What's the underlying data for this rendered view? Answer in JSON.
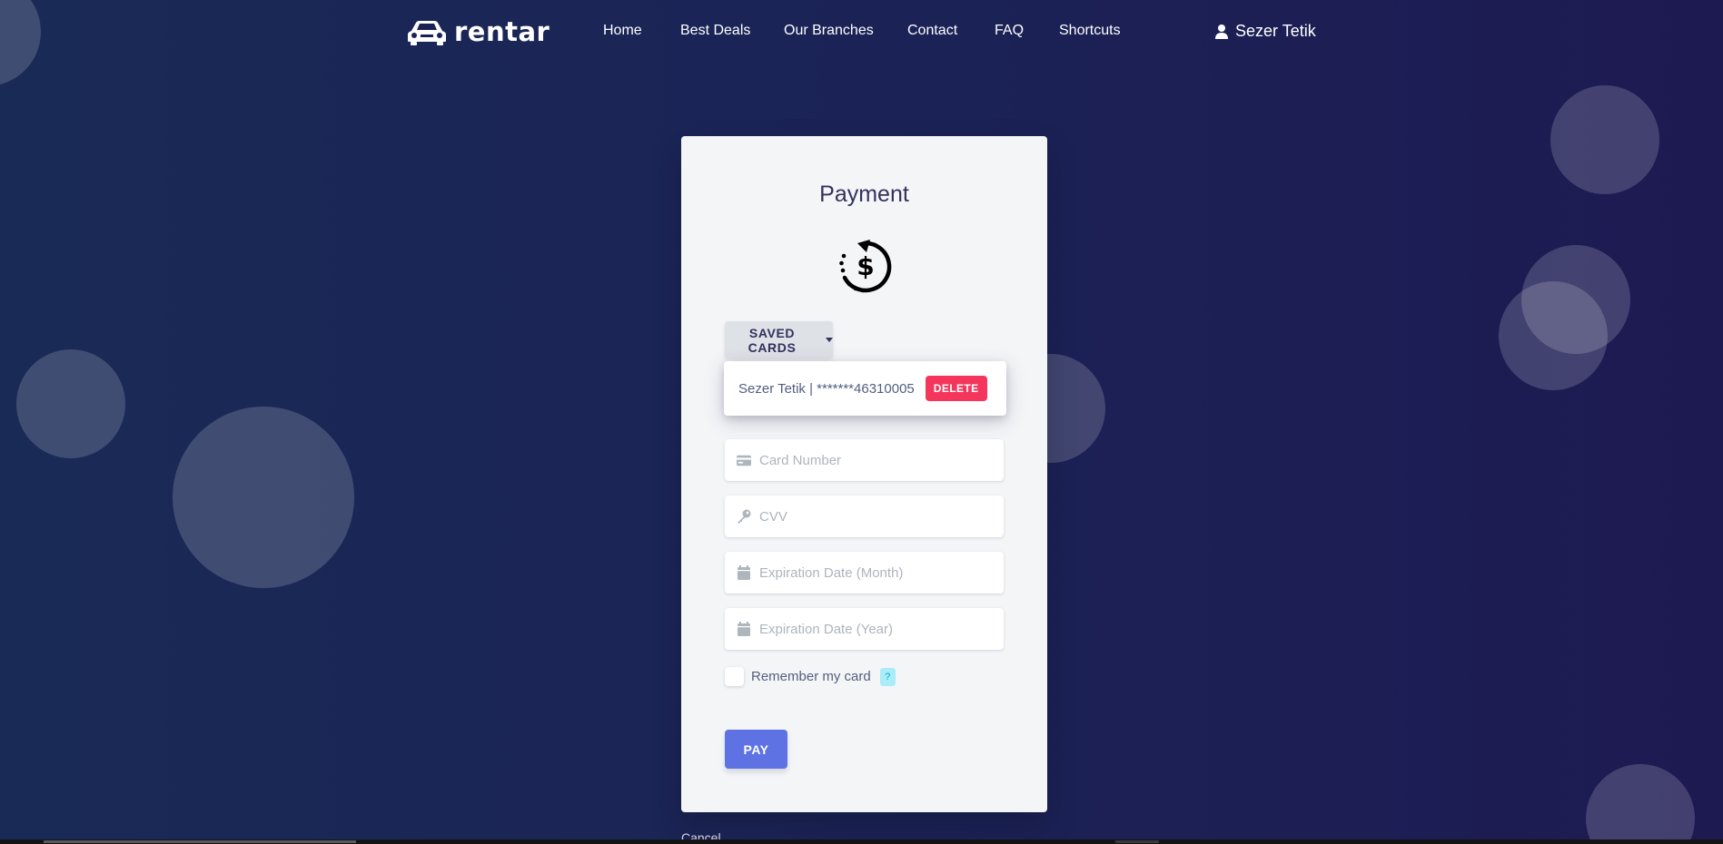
{
  "brand": {
    "name": "rentar",
    "logo_icon": "car-icon"
  },
  "nav": {
    "links": [
      "Home",
      "Best Deals",
      "Our Branches",
      "Contact",
      "FAQ",
      "Shortcuts"
    ]
  },
  "user": {
    "name": "Sezer Tetik",
    "icon": "user-icon"
  },
  "payment": {
    "title": "Payment",
    "icon": "payment-history-icon",
    "saved_cards_label": "SAVED CARDS",
    "saved_cards": [
      {
        "label": "Sezer Tetik | *******46310005",
        "delete_label": "DELETE"
      }
    ],
    "fields": {
      "card_number": {
        "placeholder": "Card Number",
        "value": "",
        "icon": "credit-card-icon"
      },
      "cvv": {
        "placeholder": "CVV",
        "value": "",
        "icon": "key-icon"
      },
      "exp_month": {
        "placeholder": "Expiration Date (Month)",
        "value": "",
        "icon": "calendar-icon"
      },
      "exp_year": {
        "placeholder": "Expiration Date (Year)",
        "value": "",
        "icon": "calendar-icon"
      }
    },
    "remember_label": "Remember my card",
    "remember_checked": false,
    "help_label": "?",
    "pay_label": "PAY",
    "cancel_label": "Cancel"
  },
  "colors": {
    "background_start": "#1a2a56",
    "background_end": "#1d1a52",
    "primary": "#5e72e4",
    "danger": "#f5365c",
    "info_light": "#aaedf9",
    "card_bg": "#f4f5f7"
  }
}
